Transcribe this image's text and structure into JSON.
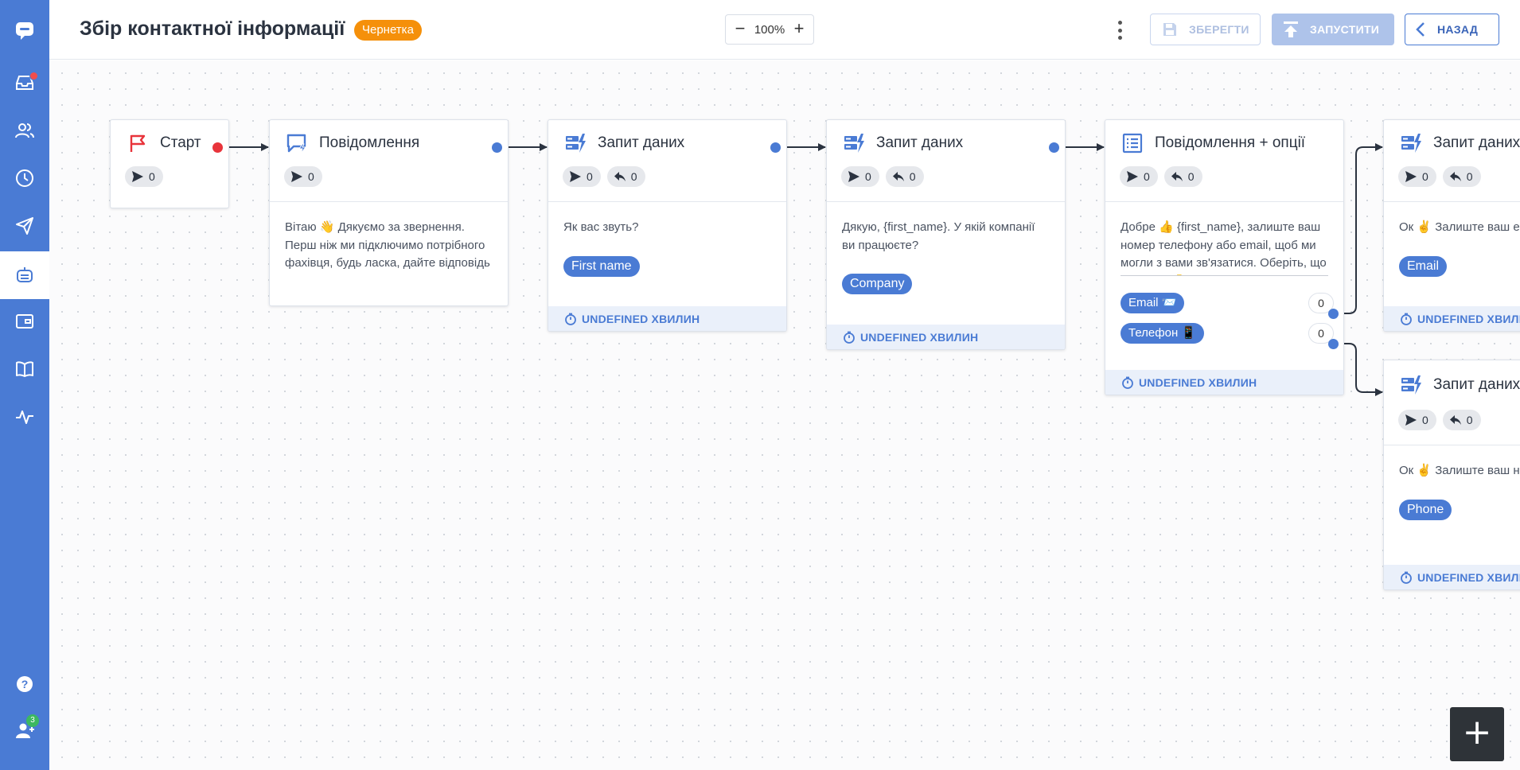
{
  "sidebar": {
    "items": [
      {
        "name": "logo-icon"
      },
      {
        "name": "inbox-icon",
        "has_notification": true
      },
      {
        "name": "contacts-icon"
      },
      {
        "name": "history-icon"
      },
      {
        "name": "broadcast-icon"
      },
      {
        "name": "bot-icon",
        "active": true
      },
      {
        "name": "widget-icon"
      },
      {
        "name": "knowledge-book-icon"
      },
      {
        "name": "analytics-icon"
      }
    ],
    "help_icon": "help-icon",
    "team_icon": "team-icon",
    "team_badge": "3"
  },
  "header": {
    "title": "Збір контактної інформації",
    "status_badge": "Чернетка",
    "zoom": "100%",
    "zoom_minus": "−",
    "zoom_plus": "+",
    "save_label": "ЗБЕРЕГТИ",
    "run_label": "ЗАПУСТИТИ",
    "back_label": "НАЗАД"
  },
  "colors": {
    "accent": "#4a7bd4",
    "badge": "#f5900a",
    "start_flag": "#e8343b"
  },
  "nodes": {
    "start": {
      "title": "Старт",
      "sent": "0"
    },
    "message": {
      "title": "Повідомлення",
      "sent": "0",
      "text": "Вітаю 👋 Дякуємо за звернення. Перш ніж ми підключимо потрібного фахівця, будь ласка, дайте відповідь на пару коротких"
    },
    "ask_name": {
      "title": "Запит даних",
      "sent": "0",
      "replies": "0",
      "text": "Як вас звуть?",
      "variable": "First name",
      "timeout": "UNDEFINED ХВИЛИН"
    },
    "ask_company": {
      "title": "Запит даних",
      "sent": "0",
      "replies": "0",
      "text": "Дякую, {first_name}. У якій компанії ви працюєте?",
      "variable": "Company",
      "timeout": "UNDEFINED ХВИЛИН"
    },
    "options": {
      "title": "Повідомлення + опції",
      "sent": "0",
      "replies": "0",
      "text": "Добре 👍 {first_name}, залиште ваш номер телефону або email, щоб ми могли з вами зв'язатися. Оберіть, що зручніше 👇",
      "option_list": [
        {
          "label": "Email 📨",
          "count": "0"
        },
        {
          "label": "Телефон 📱",
          "count": "0"
        }
      ],
      "timeout": "UNDEFINED ХВИЛИН"
    },
    "ask_email": {
      "title": "Запит даних",
      "sent": "0",
      "replies": "0",
      "text": "Ок ✌️ Залиште ваш email.",
      "variable": "Email",
      "timeout": "UNDEFINED ХВИЛИН"
    },
    "ask_phone": {
      "title": "Запит даних",
      "sent": "0",
      "replies": "0",
      "text": "Ок ✌️ Залиште ваш номер телефону.",
      "variable": "Phone",
      "timeout": "UNDEFINED ХВИЛИН"
    }
  },
  "fab": {
    "label": "+"
  }
}
